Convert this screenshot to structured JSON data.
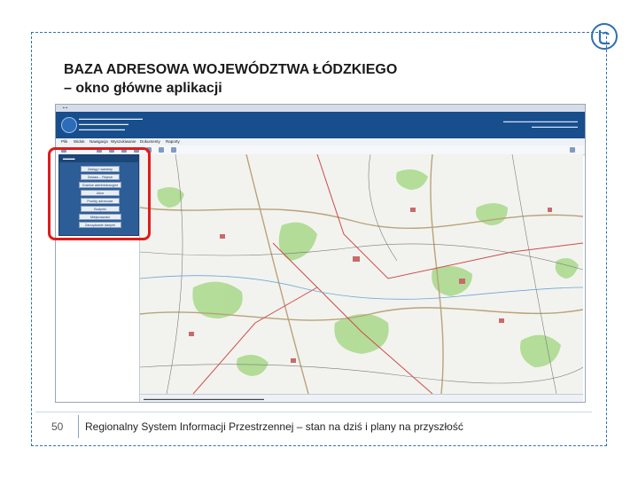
{
  "slide": {
    "title_line1": "BAZA ADRESOWA WOJEWÓDZTWA ŁÓDZKIEGO",
    "title_line2": "– okno główne aplikacji",
    "page_number": "50",
    "footer_text": "Regionalny System Informacji Przestrzennej – stan na dziś i plany na przyszłość",
    "accent_color": "#2f6fb0",
    "highlight_color": "#e01b1b"
  },
  "app": {
    "menu": [
      "Plik",
      "Widok",
      "Nawigacja",
      "Wyszukiwanie",
      "Dokumenty",
      "Raporty"
    ],
    "sidebar_buttons": [
      "Zasięg i warstwy",
      "Zestaw – Rejestr",
      "Granice administracyjne",
      "Ulice",
      "Punkty adresowe",
      "Budynki",
      "Miejscowości",
      "Zarządzanie danymi"
    ]
  }
}
